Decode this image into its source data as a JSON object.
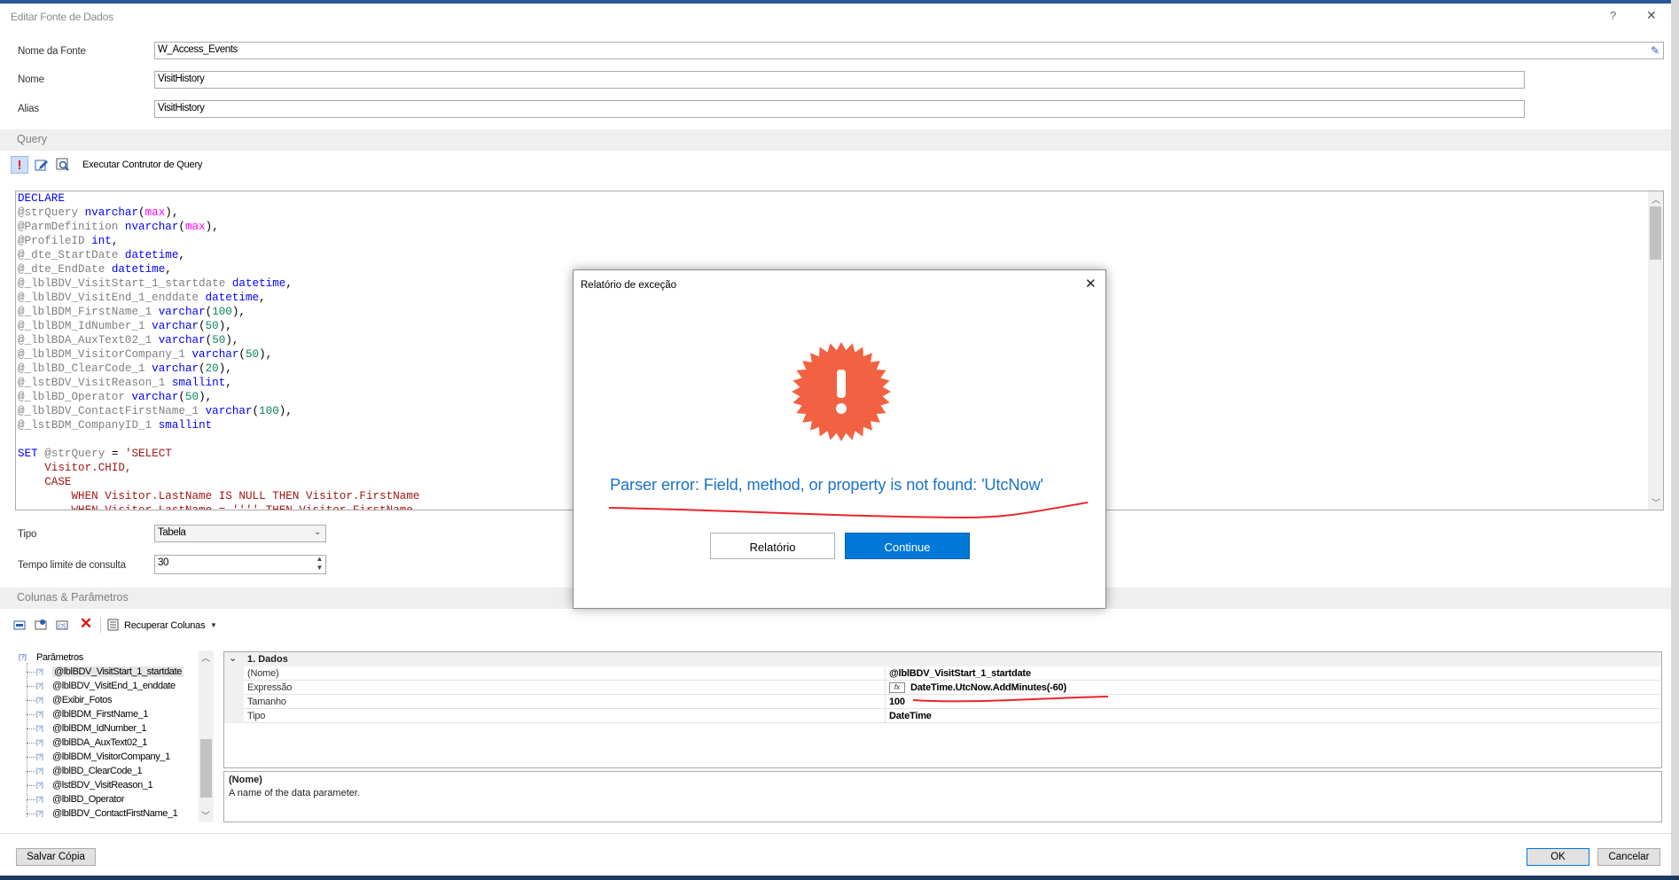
{
  "window": {
    "title": "Editar Fonte de Dados",
    "help": "?",
    "close": "✕"
  },
  "fields": {
    "source_label": "Nome da Fonte",
    "source_value": "W_Access_Events",
    "name_label": "Nome",
    "name_value": "VisitHistory",
    "alias_label": "Alias",
    "alias_value": "VisitHistory"
  },
  "query": {
    "section": "Query",
    "run_builder": "Executar Contrutor de Query",
    "lines": [
      [
        [
          "kw",
          "DECLARE"
        ]
      ],
      [
        [
          "id",
          "@strQuery "
        ],
        [
          "kw",
          "nvarchar"
        ],
        [
          "pl",
          "("
        ],
        [
          "fn",
          "max"
        ],
        [
          "pl",
          "),"
        ]
      ],
      [
        [
          "id",
          "@ParmDefinition "
        ],
        [
          "kw",
          "nvarchar"
        ],
        [
          "pl",
          "("
        ],
        [
          "fn",
          "max"
        ],
        [
          "pl",
          "),"
        ]
      ],
      [
        [
          "id",
          "@ProfileID "
        ],
        [
          "kw",
          "int"
        ],
        [
          "pl",
          ","
        ]
      ],
      [
        [
          "id",
          "@_dte_StartDate "
        ],
        [
          "kw",
          "datetime"
        ],
        [
          "pl",
          ","
        ]
      ],
      [
        [
          "id",
          "@_dte_EndDate "
        ],
        [
          "kw",
          "datetime"
        ],
        [
          "pl",
          ","
        ]
      ],
      [
        [
          "id",
          "@_lblBDV_VisitStart_1_startdate "
        ],
        [
          "kw",
          "datetime"
        ],
        [
          "pl",
          ","
        ]
      ],
      [
        [
          "id",
          "@_lblBDV_VisitEnd_1_enddate "
        ],
        [
          "kw",
          "datetime"
        ],
        [
          "pl",
          ","
        ]
      ],
      [
        [
          "id",
          "@_lblBDM_FirstName_1 "
        ],
        [
          "kw",
          "varchar"
        ],
        [
          "pl",
          "("
        ],
        [
          "num",
          "100"
        ],
        [
          "pl",
          "),"
        ]
      ],
      [
        [
          "id",
          "@_lblBDM_IdNumber_1 "
        ],
        [
          "kw",
          "varchar"
        ],
        [
          "pl",
          "("
        ],
        [
          "num",
          "50"
        ],
        [
          "pl",
          "),"
        ]
      ],
      [
        [
          "id",
          "@_lblBDA_AuxText02_1 "
        ],
        [
          "kw",
          "varchar"
        ],
        [
          "pl",
          "("
        ],
        [
          "num",
          "50"
        ],
        [
          "pl",
          "),"
        ]
      ],
      [
        [
          "id",
          "@_lblBDM_VisitorCompany_1 "
        ],
        [
          "kw",
          "varchar"
        ],
        [
          "pl",
          "("
        ],
        [
          "num",
          "50"
        ],
        [
          "pl",
          "),"
        ]
      ],
      [
        [
          "id",
          "@_lblBD_ClearCode_1 "
        ],
        [
          "kw",
          "varchar"
        ],
        [
          "pl",
          "("
        ],
        [
          "num",
          "20"
        ],
        [
          "pl",
          "),"
        ]
      ],
      [
        [
          "id",
          "@_lstBDV_VisitReason_1 "
        ],
        [
          "kw",
          "smallint"
        ],
        [
          "pl",
          ","
        ]
      ],
      [
        [
          "id",
          "@_lblBD_Operator "
        ],
        [
          "kw",
          "varchar"
        ],
        [
          "pl",
          "("
        ],
        [
          "num",
          "50"
        ],
        [
          "pl",
          "),"
        ]
      ],
      [
        [
          "id",
          "@_lblBDV_ContactFirstName_1 "
        ],
        [
          "kw",
          "varchar"
        ],
        [
          "pl",
          "("
        ],
        [
          "num",
          "100"
        ],
        [
          "pl",
          "),"
        ]
      ],
      [
        [
          "id",
          "@_lstBDM_CompanyID_1 "
        ],
        [
          "kw",
          "smallint"
        ]
      ],
      [
        [
          "pl",
          ""
        ]
      ],
      [
        [
          "kw",
          "SET "
        ],
        [
          "id",
          "@strQuery "
        ],
        [
          "pl",
          "= "
        ],
        [
          "str",
          "'SELECT"
        ]
      ],
      [
        [
          "str",
          "    Visitor.CHID,"
        ]
      ],
      [
        [
          "str",
          "    CASE"
        ]
      ],
      [
        [
          "str",
          "        WHEN Visitor.LastName IS NULL THEN Visitor.FirstName"
        ]
      ],
      [
        [
          "str",
          "        WHEN Visitor.LastName = '''' THEN Visitor.FirstName"
        ]
      ]
    ]
  },
  "settings": {
    "type_label": "Tipo",
    "type_value": "Tabela",
    "timeout_label": "Tempo limite de consulta",
    "timeout_value": "30"
  },
  "columns": {
    "section": "Colunas & Parâmetros",
    "retrieve": "Recuperar Colunas",
    "tree_root": "Parâmetros",
    "tree": [
      "@lblBDV_VisitStart_1_startdate",
      "@lblBDV_VisitEnd_1_enddate",
      "@Exibir_Fotos",
      "@lblBDM_FirstName_1",
      "@lblBDM_IdNumber_1",
      "@lblBDA_AuxText02_1",
      "@lblBDM_VisitorCompany_1",
      "@lblBD_ClearCode_1",
      "@lstBDV_VisitReason_1",
      "@lblBD_Operator",
      "@lblBDV_ContactFirstName_1"
    ],
    "grid_category": "1. Dados",
    "grid": [
      {
        "name": "(Nome)",
        "value": "@lblBDV_VisitStart_1_startdate"
      },
      {
        "name": "Expressão",
        "value": "DateTime.UtcNow.AddMinutes(-60)"
      },
      {
        "name": "Tamanho",
        "value": "100"
      },
      {
        "name": "Tipo",
        "value": "DateTime"
      }
    ],
    "desc_title": "(Nome)",
    "desc_text": "A name of the data parameter."
  },
  "footer": {
    "save_copy": "Salvar Cópia",
    "ok": "OK",
    "cancel": "Cancelar"
  },
  "dialog": {
    "title": "Relatório de exceção",
    "message": "Parser error: Field, method, or property is not found: 'UtcNow'",
    "report": "Relatório",
    "continue": "Continue"
  },
  "colors": {
    "error_badge": "#f26141",
    "accent": "#0078d7",
    "annotation": "#e8262a"
  }
}
